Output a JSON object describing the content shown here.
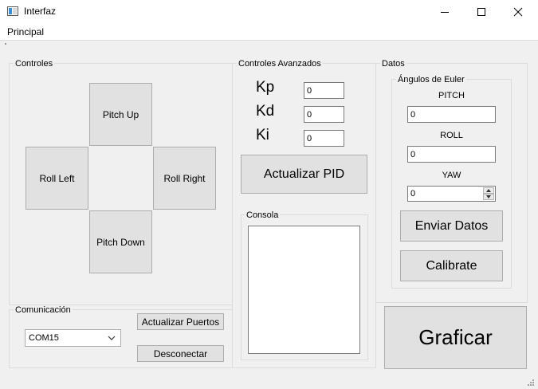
{
  "window": {
    "title": "Interfaz"
  },
  "menu": {
    "principal": "Principal"
  },
  "controles": {
    "label": "Controles",
    "pitch_up": "Pitch Up",
    "roll_left": "Roll Left",
    "roll_right": "Roll Right",
    "pitch_down": "Pitch Down"
  },
  "comunicacion": {
    "label": "Comunicación",
    "port": "COM15",
    "actualizar_puertos": "Actualizar Puertos",
    "desconectar": "Desconectar"
  },
  "avanzados": {
    "label": "Controles Avanzados",
    "kp_label": "Kp",
    "kp_value": "0",
    "kd_label": "Kd",
    "kd_value": "0",
    "ki_label": "Ki",
    "ki_value": "0",
    "actualizar_pid": "Actualizar PID",
    "consola_label": "Consola"
  },
  "datos": {
    "label": "Datos",
    "euler_label": "Ángulos de Euler",
    "pitch_label": "PITCH",
    "pitch_value": "0",
    "roll_label": "ROLL",
    "roll_value": "0",
    "yaw_label": "YAW",
    "yaw_value": "0",
    "enviar_datos": "Enviar Datos",
    "calibrate": "Calibrate"
  },
  "graficar": "Graficar"
}
